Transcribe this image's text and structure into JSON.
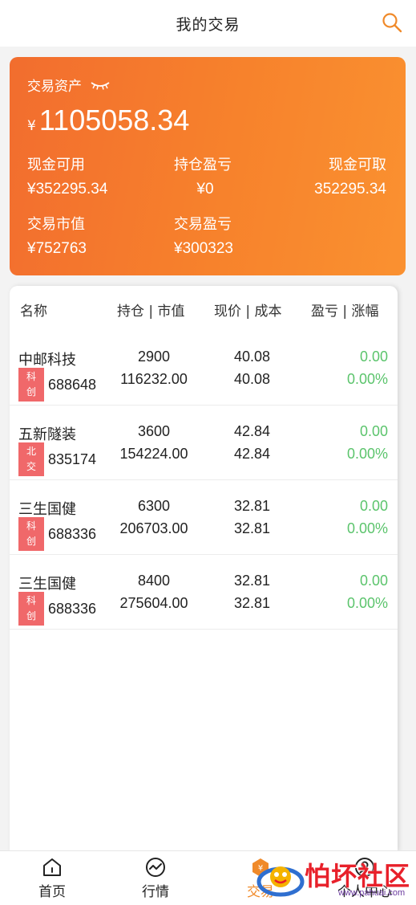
{
  "header": {
    "title": "我的交易",
    "search_icon": "search-icon"
  },
  "summary": {
    "asset_label": "交易资产",
    "currency": "¥",
    "total_assets": "1105058.34",
    "cash_available_label": "现金可用",
    "cash_available_value": "¥352295.34",
    "holding_pl_label": "持仓盈亏",
    "holding_pl_value": "¥0",
    "cash_withdrawable_label": "现金可取",
    "cash_withdrawable_value": "352295.34",
    "market_value_label": "交易市值",
    "market_value_value": "¥752763",
    "trade_pl_label": "交易盈亏",
    "trade_pl_value": "¥300323",
    "gradient_start": "#f26d2e",
    "gradient_end": "#fa9130"
  },
  "table": {
    "headers": {
      "name": "名称",
      "position": "持仓 | 市值",
      "price": "现价 | 成本",
      "pl": "盈亏 | 涨幅"
    },
    "rows": [
      {
        "name": "中邮科技",
        "board": "科创",
        "code": "688648",
        "shares": "2900",
        "market_value": "116232.00",
        "price": "40.08",
        "cost": "40.08",
        "pl": "0.00",
        "change": "0.00%"
      },
      {
        "name": "五新隧装",
        "board": "北交",
        "code": "835174",
        "shares": "3600",
        "market_value": "154224.00",
        "price": "42.84",
        "cost": "42.84",
        "pl": "0.00",
        "change": "0.00%"
      },
      {
        "name": "三生国健",
        "board": "科创",
        "code": "688336",
        "shares": "6300",
        "market_value": "206703.00",
        "price": "32.81",
        "cost": "32.81",
        "pl": "0.00",
        "change": "0.00%"
      },
      {
        "name": "三生国健",
        "board": "科创",
        "code": "688336",
        "shares": "8400",
        "market_value": "275604.00",
        "price": "32.81",
        "cost": "32.81",
        "pl": "0.00",
        "change": "0.00%"
      }
    ],
    "positive_color": "#5bc46c",
    "board_tag_color": "#f0686a"
  },
  "tabbar": {
    "items": [
      {
        "label": "首页",
        "icon": "home-icon"
      },
      {
        "label": "行情",
        "icon": "market-icon"
      },
      {
        "label": "交易",
        "icon": "trade-icon",
        "active": true
      },
      {
        "label": "个人中心",
        "icon": "user-icon"
      }
    ],
    "accent": "#f08a2a"
  },
  "watermark": {
    "text": "怕坏社区",
    "url": "www.pahuai.com"
  }
}
